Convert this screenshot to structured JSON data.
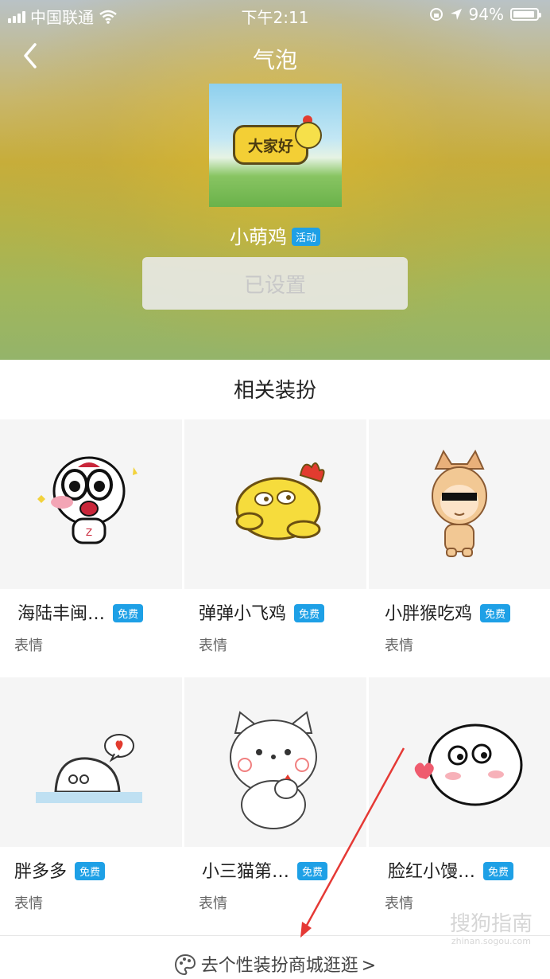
{
  "status_bar": {
    "carrier": "中国联通",
    "time": "下午2:11",
    "battery_pct": "94%",
    "battery_level": 0.94
  },
  "navbar": {
    "title": "气泡",
    "back_icon": "chevron-left-icon"
  },
  "current_item": {
    "preview_text": "大家好",
    "name": "小萌鸡",
    "badge": "活动",
    "button_label": "已设置"
  },
  "related": {
    "title": "相关装扮",
    "items": [
      {
        "name": "海陆丰闽…",
        "badge": "免费",
        "type": "表情"
      },
      {
        "name": "弹弹小飞鸡",
        "badge": "免费",
        "type": "表情"
      },
      {
        "name": "小胖猴吃鸡",
        "badge": "免费",
        "type": "表情"
      },
      {
        "name": "胖多多",
        "badge": "免费",
        "type": "表情"
      },
      {
        "name": "小三猫第…",
        "badge": "免费",
        "type": "表情"
      },
      {
        "name": "脸红小馒…",
        "badge": "免费",
        "type": "表情"
      }
    ]
  },
  "footer": {
    "label": "去个性装扮商城逛逛",
    "chevron": ">"
  },
  "watermark": {
    "text": "搜狗指南",
    "url": "zhinan.sogou.com"
  },
  "colors": {
    "accent": "#1ea0e6",
    "annotation_arrow": "#e53935"
  }
}
